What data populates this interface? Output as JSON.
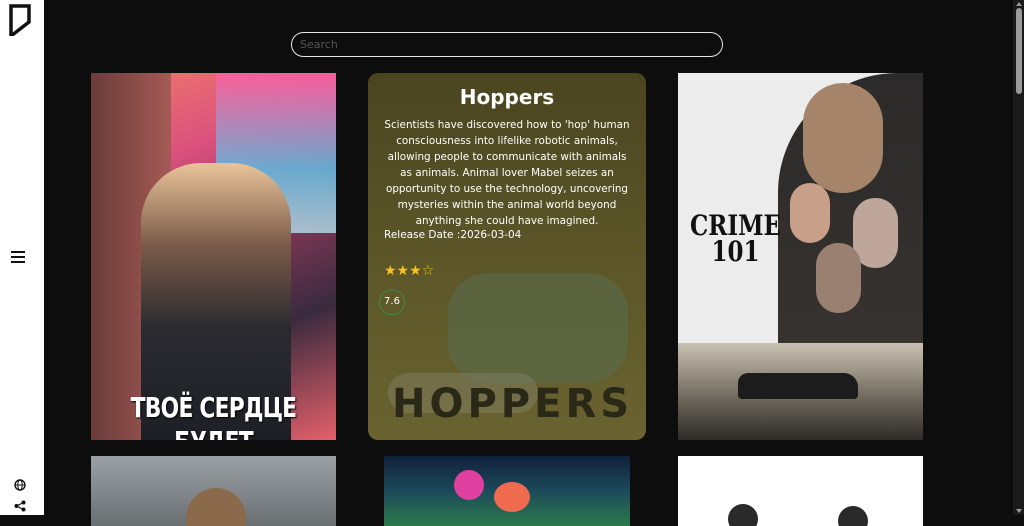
{
  "search": {
    "placeholder": "Search"
  },
  "icons": {
    "logo": "logo-icon",
    "menu": "hamburger-menu-icon",
    "language": "globe-icon",
    "share": "share-icon"
  },
  "posters": [
    {
      "title_line1": "ТВОЁ СЕРДЦЕ",
      "title_line2": "БУДЕТ РАЗБИТО"
    },
    {
      "title": "Hoppers",
      "description": "Scientists have discovered how to 'hop' human consciousness into lifelike robotic animals, allowing people to communicate with animals as animals. Animal lover Mabel seizes an opportunity to use the technology, uncovering mysteries within the animal world beyond anything she could have imagined.",
      "release_date": "Release Date :2026-03-04",
      "stars": "★★★☆",
      "rating": "7.6",
      "rating_value": 7.6,
      "poster_text": "HOPPERS"
    },
    {
      "title_line1": "CRIME",
      "title_line2": "101"
    }
  ],
  "colors": {
    "background": "#0d0d0d",
    "sidebar": "#ffffff",
    "star": "#f5c518",
    "rating_ring": "#3a8a4a"
  }
}
